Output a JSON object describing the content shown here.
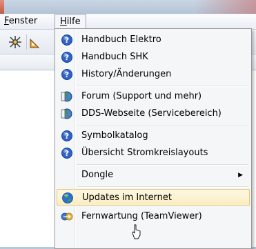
{
  "menubar": {
    "fenster": {
      "accel": "F",
      "rest": "enster"
    },
    "hilfe": {
      "accel": "H",
      "rest": "ilfe"
    }
  },
  "menu": {
    "items": [
      {
        "label": "Handbuch Elektro",
        "icon": "help-icon"
      },
      {
        "label": "Handbuch SHK",
        "icon": "help-icon"
      },
      {
        "label": "History/Änderungen",
        "icon": "help-icon"
      },
      {
        "label": "Forum (Support und mehr)",
        "icon": "globe-web-icon"
      },
      {
        "label": "DDS-Webseite (Servicebereich)",
        "icon": "globe-web-icon"
      },
      {
        "label": "Symbolkatalog",
        "icon": "help-icon"
      },
      {
        "label": "Übersicht Stromkreislayouts",
        "icon": "help-icon"
      },
      {
        "label": "Dongle",
        "icon": "submenu-arrow-icon"
      },
      {
        "label": "Updates im Internet",
        "icon": "globe-icon",
        "highlighted": true
      },
      {
        "label": "Fernwartung (TeamViewer)",
        "icon": "teamviewer-icon"
      }
    ]
  },
  "colors": {
    "highlight_bg": "#fbeec3",
    "highlight_border": "#e3c77a",
    "help_icon_blue": "#2f63c8"
  }
}
